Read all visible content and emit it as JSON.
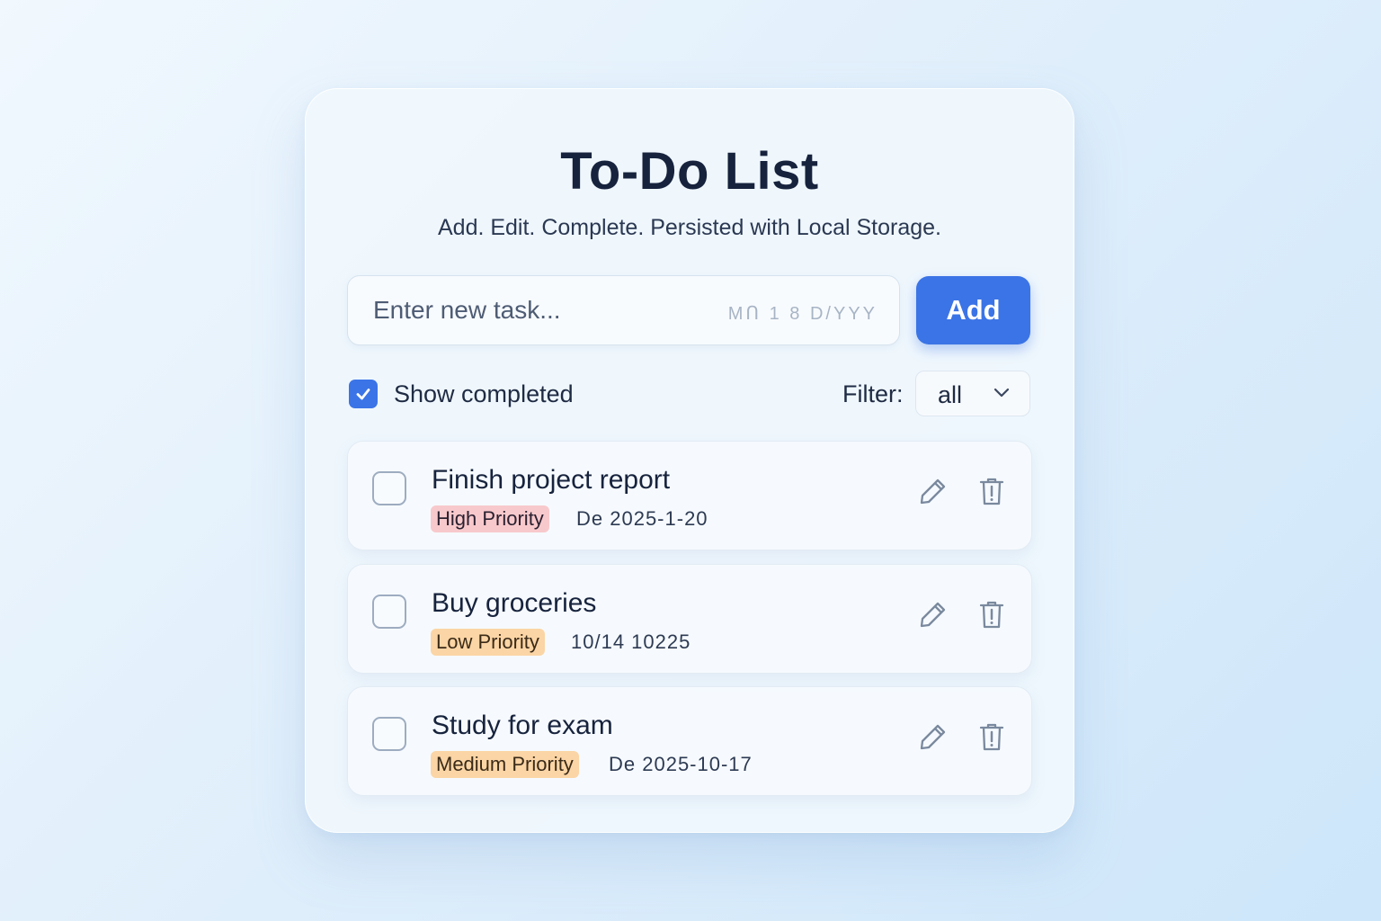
{
  "header": {
    "title": "To-Do List",
    "subtitle": "Add. Edit. Complete. Persisted with Local Storage."
  },
  "new_task": {
    "placeholder": "Enter new task...",
    "date_hint": "MՈ 1 8 D/YYY",
    "add_label": "Add"
  },
  "controls": {
    "show_completed_label": "Show completed",
    "show_completed_checked": true,
    "filter_label": "Filter:",
    "filter_value": "all"
  },
  "tasks": [
    {
      "title": "Finish project report",
      "priority": "High Priority",
      "date": "De 2025-1-20",
      "completed": false
    },
    {
      "title": "Buy groceries",
      "priority": "Low Priority",
      "date": "10/14 10225",
      "completed": false
    },
    {
      "title": "Study for exam",
      "priority": "Medium Priority",
      "date": "De 2025-10-17",
      "completed": false
    }
  ],
  "icons": {
    "checkmark": "check-icon",
    "chevron": "chevron-down-icon",
    "edit": "pencil-icon",
    "delete": "trash-icon"
  },
  "colors": {
    "accent": "#3b74e6",
    "title": "#17233d",
    "high_priority_bg": "#f8c9cc",
    "low_priority_bg": "#fbd5a5",
    "medium_priority_bg": "#fbd5a5",
    "icon": "#7a899e"
  }
}
